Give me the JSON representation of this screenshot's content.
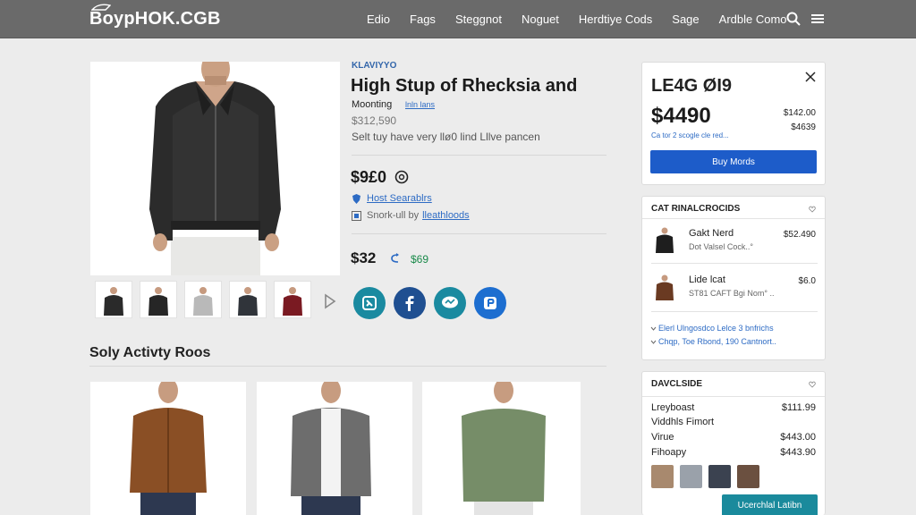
{
  "header": {
    "logo": "BoypHOK.CGB",
    "nav": [
      "Edio",
      "Fags",
      "Steggnot",
      "Noguet",
      "Herdtiye Cods",
      "Sage",
      "Ardble Como"
    ]
  },
  "product": {
    "brand": "KLAVIYYO",
    "title": "High Stup of Rhecksia and",
    "subtitle": "Moonting",
    "subtitle_link": "lnln lans",
    "old_price": "$312,590",
    "description": "Selt tuy have very llø0 lind Lllve pancen",
    "price": "$9£0",
    "link1": "Host Searablrs",
    "link2_prefix": "Snork-ull by",
    "link2": "lleathloods",
    "price2": "$32",
    "price2_alt": "$69"
  },
  "section": {
    "title": "Soly Activty Roos"
  },
  "buybox": {
    "heading": "LE4G ØI9",
    "price": "$4490",
    "side_price_1": "$142.00",
    "side_price_2": "$4639",
    "cart_note": "Ca tor 2 scogle cle red...",
    "button": "Buy Mords"
  },
  "recs": {
    "title": "CAT RINALCROCIDS",
    "items": [
      {
        "name": "Gakt Nerd",
        "sub": "Dot Valsel Cock..°",
        "price": "$52.490"
      },
      {
        "name": "Lide lcat",
        "sub": "ST81 CAFT Bgi Nom° ..",
        "price": "$6.0"
      }
    ],
    "info_1": "Elerl Ulngosdco Lelce 3 bnfrichs",
    "info_2": "Chqp, Toe Rbond, 190 Cantnort.."
  },
  "details": {
    "title": "DAVCLSIDE",
    "rows": [
      {
        "label": "Lreyboast",
        "price": "$111.99"
      },
      {
        "label": "Viddhls Fimort",
        "price": ""
      },
      {
        "label": "Virue",
        "price": "$443.00"
      },
      {
        "label": "Fihoapy",
        "price": "$443.90"
      }
    ],
    "cta": "Ucerchlal Latibn"
  },
  "colors": {
    "topbar": "#6a6a6a",
    "accent_blue": "#1d5cc9",
    "accent_teal": "#1a8a9c",
    "price_green": "#1a8a4a"
  }
}
